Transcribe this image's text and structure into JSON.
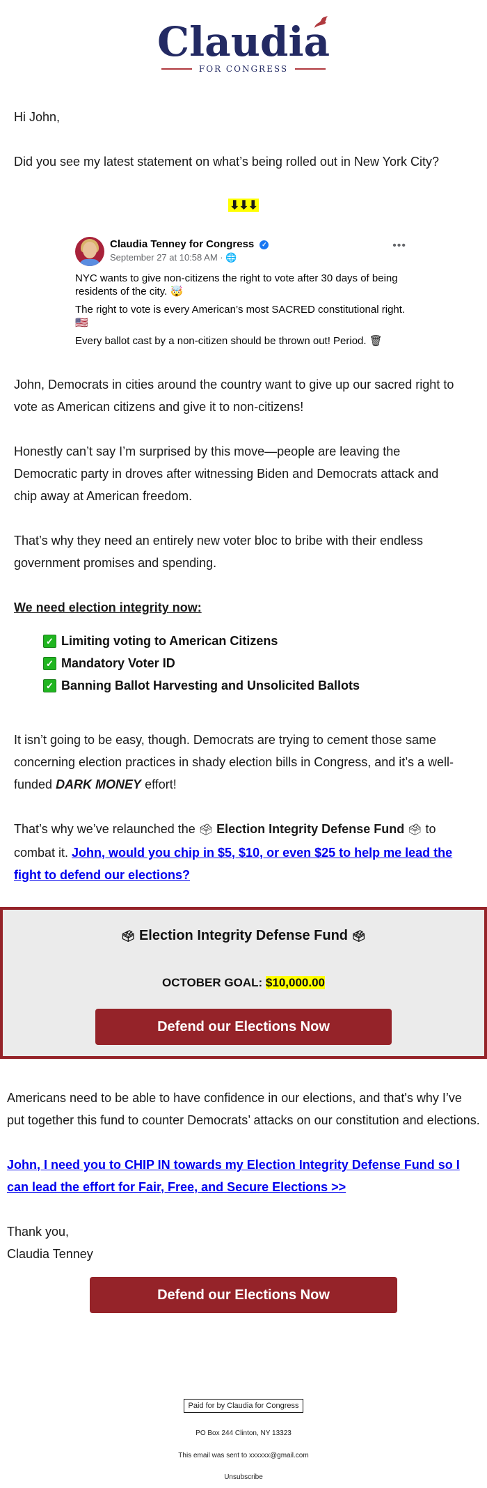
{
  "logo": {
    "name": "Claudia",
    "subtitle": "FOR CONGRESS",
    "brand_color": "#232a63",
    "accent_color": "#b03a3f"
  },
  "greeting": "Hi John,",
  "intro": "Did you see my latest statement on what’s being rolled out in New York City?",
  "arrows": "⬇⬇⬇",
  "fb_post": {
    "author": "Claudia Tenney for Congress",
    "verified_icon": "✓",
    "meta": "September 27 at 10:58 AM · 🌐",
    "more_icon": "•••",
    "paragraphs": [
      "NYC wants to give non-citizens the right to vote after 30 days of being residents of the city. 🤯",
      "The right to vote is every American’s most SACRED constitutional right. 🇺🇸",
      "Every ballot cast by a non-citizen should be thrown out! Period. 🗑"
    ]
  },
  "body": {
    "p1": "John, Democrats in cities around the country want to give up our sacred right to vote as American citizens and give it to non-citizens!",
    "p2": "Honestly can’t say I’m surprised by this move—people are leaving the Democratic party in droves after witnessing Biden and Democrats attack and chip away at American freedom.",
    "p3": "That’s why they need an entirely new voter bloc to bribe with their endless government promises and spending.",
    "heading": "We need election integrity now:",
    "checklist": [
      "Limiting voting to American Citizens",
      "Mandatory Voter ID",
      "Banning Ballot Harvesting and Unsolicited Ballots"
    ],
    "check_icon": "✓",
    "p4_start": "It isn’t going to be easy, though. Democrats are trying to cement those same concerning election practices in shady election bills in Congress, and it’s a well-funded ",
    "p4_emph": "DARK MONEY",
    "p4_end": " effort!",
    "p5_start": "That’s why we’ve relaunched the ",
    "ballot_icon": "🗳",
    "p5_fund": "Election Integrity Defense Fund",
    "p5_mid": " to combat it. ",
    "p5_link": "John, would you chip in $5, $10, or even $25 to help me lead the fight to defend our elections?"
  },
  "fund_box": {
    "title": "Election Integrity Defense Fund",
    "goal_label": "OCTOBER GOAL: ",
    "goal_value": "$10,000.00",
    "button_label": "Defend our Elections Now"
  },
  "closing": {
    "p1": "Americans need to be able to have confidence in our elections, and that's why I’ve put together this fund to counter Democrats’ attacks on our constitution and elections.",
    "link": "John, I need you to CHIP IN towards my Election Integrity Defense Fund so I can lead the effort for Fair, Free, and Secure Elections >>",
    "thanks": "Thank you,",
    "signature": "Claudia Tenney",
    "button_label": "Defend our Elections Now"
  },
  "footer": {
    "paid_for": "Paid for by Claudia for Congress",
    "address": "PO Box 244 Clinton, NY 13323",
    "sent_to": "This email was sent to xxxxxx@gmail.com",
    "unsubscribe": "Unsubscribe"
  },
  "colors": {
    "button": "#952329",
    "link": "#0000ee",
    "highlight": "#ffff00",
    "box_bg": "#ebebeb"
  }
}
